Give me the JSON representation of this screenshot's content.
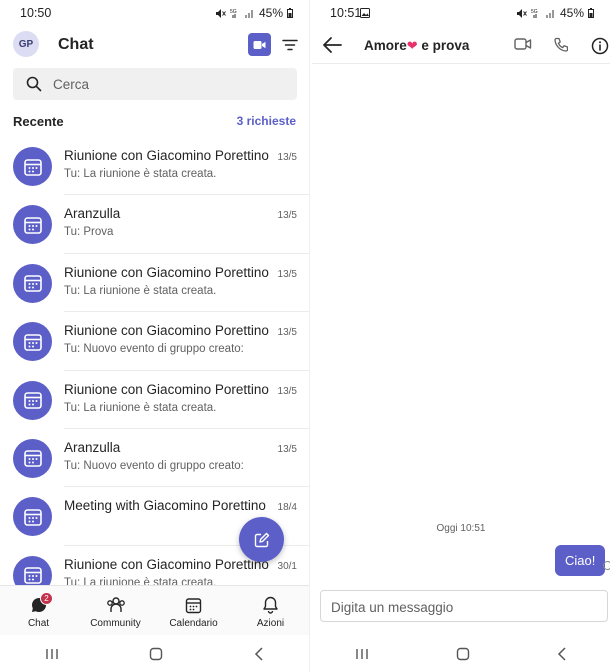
{
  "left": {
    "status": {
      "time": "10:50",
      "battery": "45%"
    },
    "header": {
      "avatar_initials": "GP",
      "title": "Chat"
    },
    "search": {
      "placeholder": "Cerca"
    },
    "section": {
      "title": "Recente",
      "requests_link": "3 richieste"
    },
    "chats": [
      {
        "name": "Riunione con Giacomino Porettino",
        "date": "13/5",
        "preview": "Tu: La riunione è stata creata."
      },
      {
        "name": "Aranzulla",
        "date": "13/5",
        "preview": "Tu: Prova"
      },
      {
        "name": "Riunione con Giacomino Porettino",
        "date": "13/5",
        "preview": "Tu: La riunione è stata creata."
      },
      {
        "name": "Riunione con Giacomino Porettino",
        "date": "13/5",
        "preview": "Tu: Nuovo evento di gruppo creato:"
      },
      {
        "name": "Riunione con Giacomino Porettino",
        "date": "13/5",
        "preview": "Tu: La riunione è stata creata."
      },
      {
        "name": "Aranzulla",
        "date": "13/5",
        "preview": "Tu: Nuovo evento di gruppo creato:"
      },
      {
        "name": "Meeting with Giacomino Porettino",
        "date": "18/4",
        "preview": ""
      },
      {
        "name": "Riunione con Giacomino Porettino",
        "date": "30/1",
        "preview": "Tu: La riunione è stata creata."
      }
    ],
    "nav": {
      "chat": {
        "label": "Chat",
        "badge": "2"
      },
      "community": {
        "label": "Community"
      },
      "calendar": {
        "label": "Calendario"
      },
      "actions": {
        "label": "Azioni"
      }
    }
  },
  "right": {
    "status": {
      "time": "10:51",
      "battery": "45%"
    },
    "header": {
      "title_before": "Amore",
      "title_heart": "❤",
      "title_after": " e prova"
    },
    "day_stamp": "Oggi 10:51",
    "messages": [
      {
        "text": "Ciao!",
        "sender": "me"
      }
    ],
    "composer": {
      "placeholder": "Digita un messaggio"
    }
  },
  "colors": {
    "accent": "#5b5fc7",
    "badge": "#c4314b",
    "heart": "#e8306a"
  },
  "icons": [
    "search-icon",
    "video-camera-icon",
    "filter-icon",
    "calendar-icon",
    "compose-icon",
    "chat-icon",
    "community-icon",
    "calendar-icon",
    "bell-icon",
    "back-arrow-icon",
    "phone-icon",
    "info-icon"
  ]
}
